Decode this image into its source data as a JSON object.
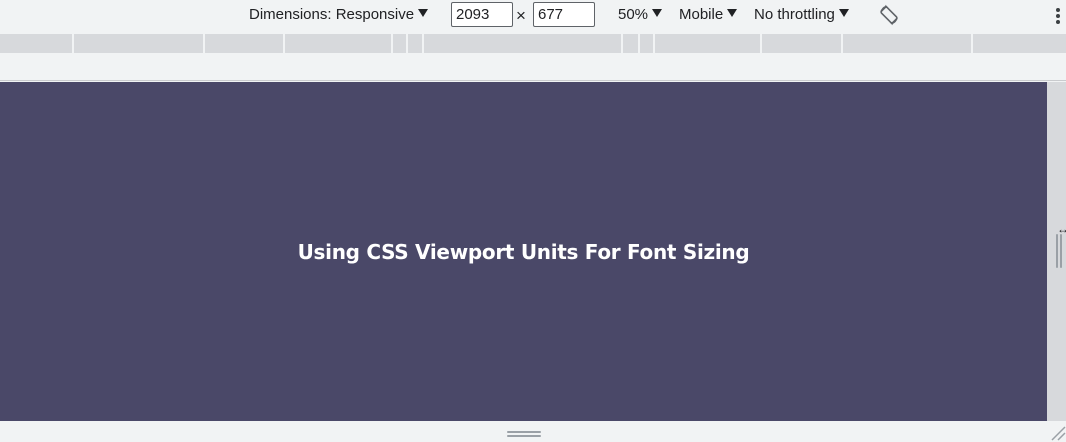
{
  "toolbar": {
    "dimensions_label": "Dimensions: Responsive",
    "width_value": "2093",
    "times_symbol": "×",
    "height_value": "677",
    "zoom_label": "50%",
    "device_type_label": "Mobile",
    "throttling_label": "No throttling",
    "rotate_icon": "rotate-icon",
    "more_icon": "kebab-menu-icon"
  },
  "viewport": {
    "background_color": "#4a4868",
    "heading": "Using CSS Viewport Units For Font Sizing"
  },
  "colors": {
    "toolbar_bg": "#f1f3f4",
    "media_query_bar": "#d7d9dc",
    "text": "#202124"
  }
}
